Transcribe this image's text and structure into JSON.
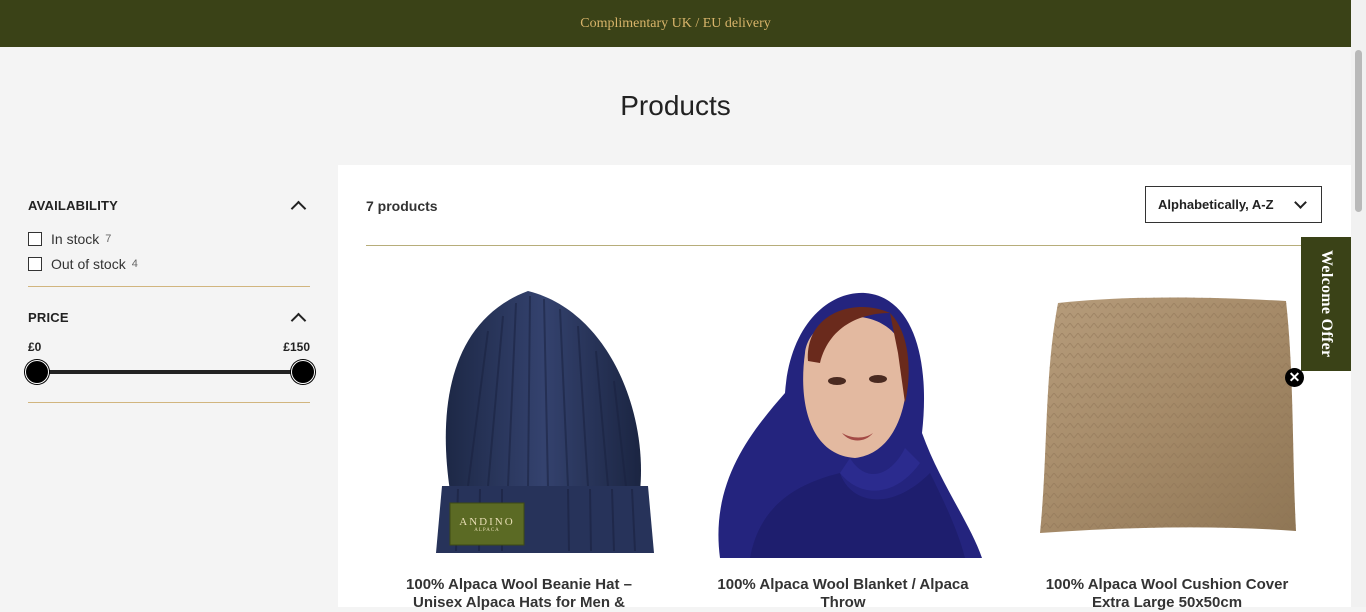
{
  "announcement": "Complimentary UK / EU delivery",
  "page_title": "Products",
  "filters": {
    "availability": {
      "heading": "AVAILABILITY",
      "options": [
        {
          "label": "In stock",
          "count": "7"
        },
        {
          "label": "Out of stock",
          "count": "4"
        }
      ]
    },
    "price": {
      "heading": "PRICE",
      "min_label": "£0",
      "max_label": "£150"
    }
  },
  "results": {
    "count_label": "7 products",
    "sort_label": "Alphabetically, A-Z"
  },
  "products": [
    {
      "title": "100% Alpaca Wool Beanie Hat – Unisex Alpaca Hats for Men &",
      "badge_text": "ANDINO",
      "badge_sub": "ALPACA"
    },
    {
      "title": "100% Alpaca Wool Blanket / Alpaca Throw"
    },
    {
      "title": "100% Alpaca Wool Cushion Cover Extra Large 50x50cm"
    }
  ],
  "welcome_offer": "Welcome Offer",
  "close_glyph": "✕",
  "colors": {
    "brand_green": "#3a4217",
    "gold": "#d8b46a"
  }
}
